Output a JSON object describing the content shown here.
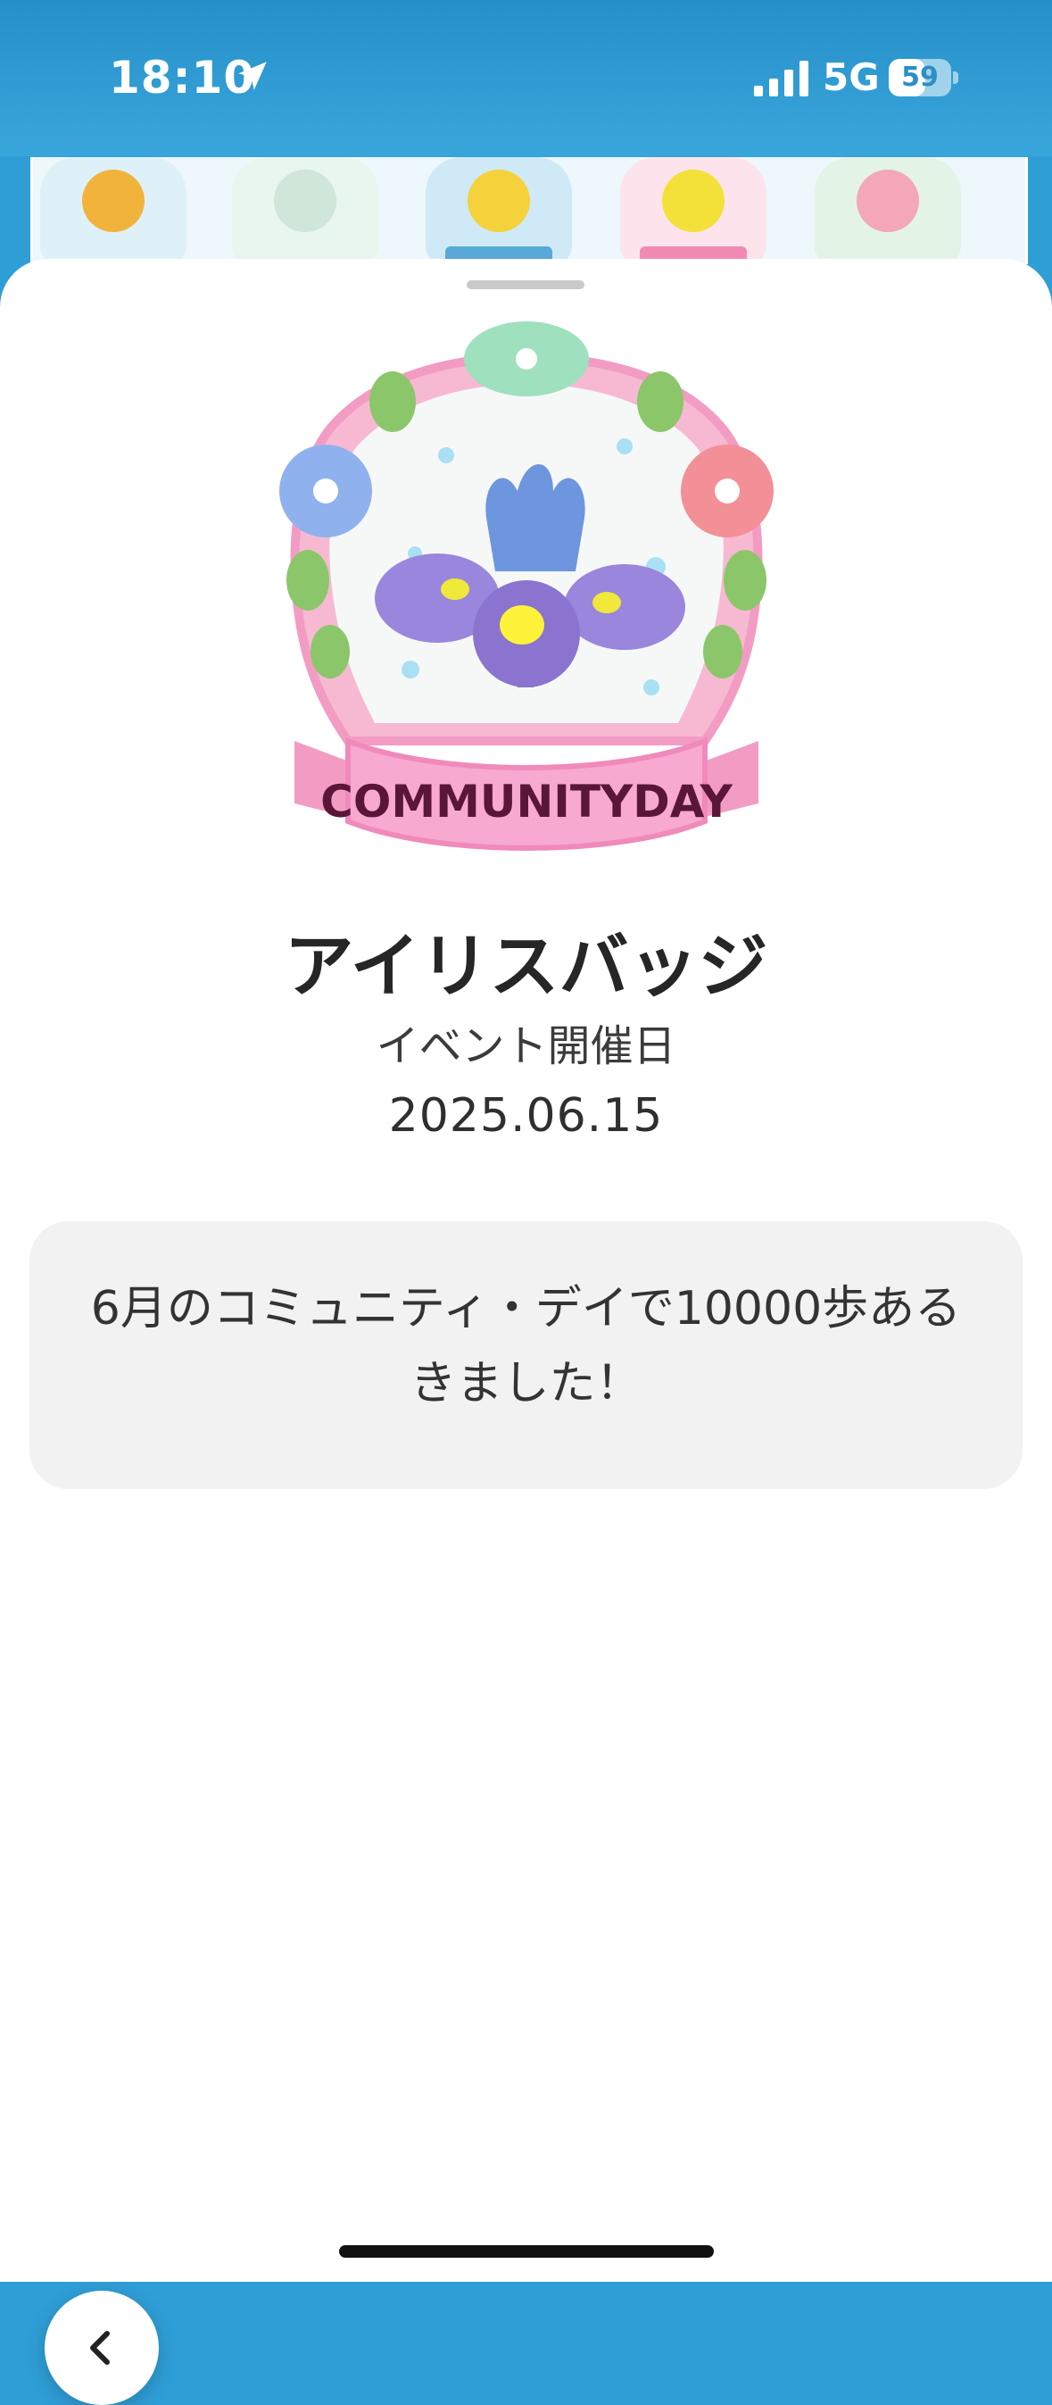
{
  "status_bar": {
    "time": "18:10",
    "network": "5G",
    "battery": "59",
    "battery_level": 59,
    "icons": [
      "location-arrow-icon",
      "signal-bars-icon",
      "battery-icon"
    ]
  },
  "badge_strip": {
    "colors": [
      "#f2b33d",
      "#cfe6d8",
      "#f5d23b",
      "#f3e13a",
      "#f3a7b7"
    ]
  },
  "badge": {
    "ribbon_text": "COMMUNITYDAY",
    "name": "アイリスバッジ",
    "event_label": "イベント開催日",
    "event_date": "2025.06.15",
    "description": "6月のコミュニティ・デイで10000歩あるきました！"
  },
  "nav": {
    "back_icon": "chevron-left-icon"
  },
  "colors": {
    "header_blue": "#2f9ed6",
    "ribbon_pink": "#f49ac6",
    "ribbon_text": "#5a1638",
    "title_text": "#262626"
  }
}
